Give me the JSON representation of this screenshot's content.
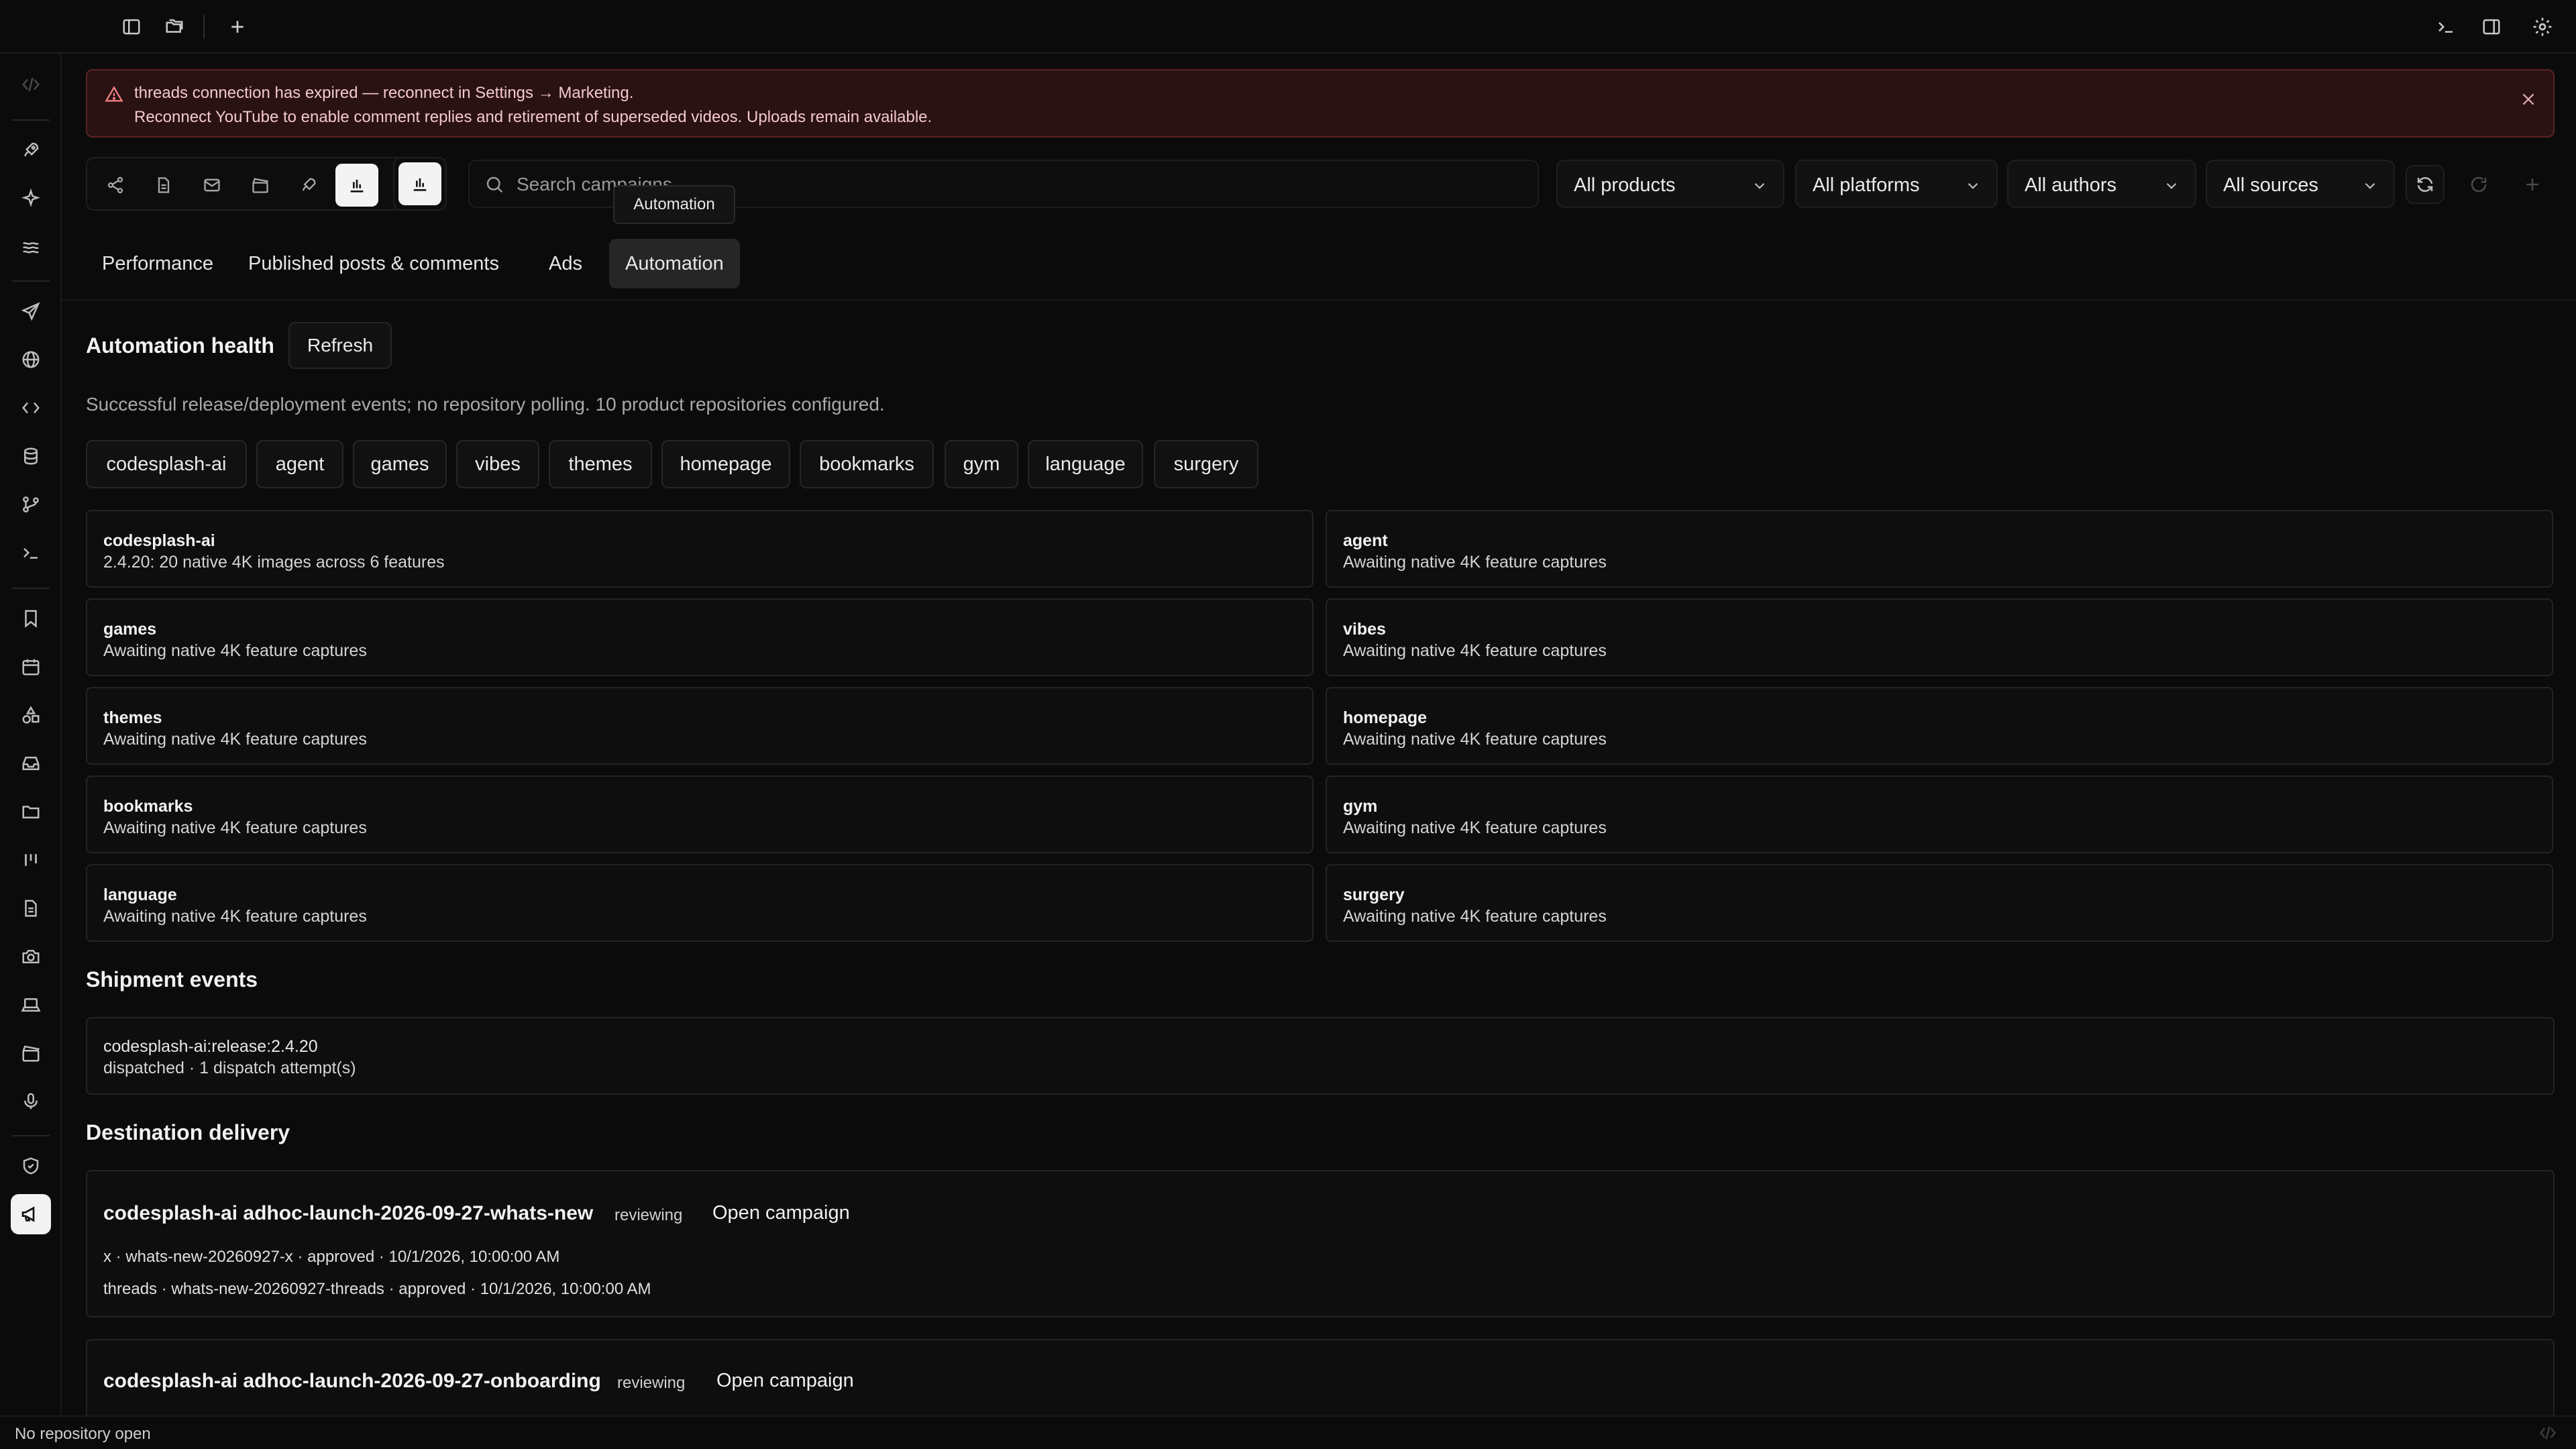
{
  "alert": {
    "line1": "threads connection has expired — reconnect in Settings → Marketing.",
    "line2": "Reconnect YouTube to enable comment replies and retirement of superseded videos. Uploads remain available."
  },
  "tooltip": "Automation",
  "search": {
    "placeholder": "Search campaigns"
  },
  "filters": {
    "products": "All products",
    "platforms": "All platforms",
    "authors": "All authors",
    "sources": "All sources"
  },
  "tabs": [
    "Performance",
    "Published posts & comments",
    "Ads",
    "Automation"
  ],
  "health": {
    "title": "Automation health",
    "refresh": "Refresh",
    "description": "Successful release/deployment events; no repository polling. 10 product repositories configured.",
    "chips": [
      "codesplash-ai",
      "agent",
      "games",
      "vibes",
      "themes",
      "homepage",
      "bookmarks",
      "gym",
      "language",
      "surgery"
    ],
    "cards": [
      {
        "name": "codesplash-ai",
        "status": "2.4.20: 20 native 4K images across 6 features"
      },
      {
        "name": "agent",
        "status": "Awaiting native 4K feature captures"
      },
      {
        "name": "games",
        "status": "Awaiting native 4K feature captures"
      },
      {
        "name": "vibes",
        "status": "Awaiting native 4K feature captures"
      },
      {
        "name": "themes",
        "status": "Awaiting native 4K feature captures"
      },
      {
        "name": "homepage",
        "status": "Awaiting native 4K feature captures"
      },
      {
        "name": "bookmarks",
        "status": "Awaiting native 4K feature captures"
      },
      {
        "name": "gym",
        "status": "Awaiting native 4K feature captures"
      },
      {
        "name": "language",
        "status": "Awaiting native 4K feature captures"
      },
      {
        "name": "surgery",
        "status": "Awaiting native 4K feature captures"
      }
    ]
  },
  "shipment": {
    "title": "Shipment events",
    "event": "codesplash-ai:release:2.4.20",
    "detail": "dispatched · 1 dispatch attempt(s)"
  },
  "delivery": {
    "title": "Destination delivery",
    "items": [
      {
        "title": "codesplash-ai adhoc-launch-2026-09-27-whats-new",
        "status": "reviewing",
        "open": "Open campaign",
        "lines": [
          "x · whats-new-20260927-x · approved · 10/1/2026, 10:00:00 AM",
          "threads · whats-new-20260927-threads · approved · 10/1/2026, 10:00:00 AM"
        ]
      },
      {
        "title": "codesplash-ai adhoc-launch-2026-09-27-onboarding",
        "status": "reviewing",
        "open": "Open campaign",
        "lines": []
      }
    ]
  },
  "statusbar": {
    "text": "No repository open"
  },
  "colors": {
    "background": "#0b0b0b",
    "alert_bg": "#2a1214",
    "alert_border": "#5c2227",
    "active_tab": "#262626"
  }
}
